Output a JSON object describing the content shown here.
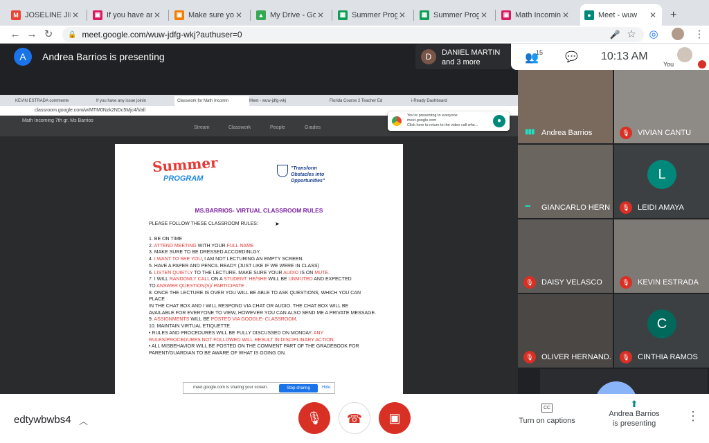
{
  "browser": {
    "tabs": [
      {
        "title": "JOSELINE JIME",
        "favicon": "gmail-icon",
        "color": "#ea4335",
        "glyph": "M"
      },
      {
        "title": "If you have any",
        "favicon": "classroom-icon",
        "color": "#d81b60",
        "glyph": "▣"
      },
      {
        "title": "Make sure you",
        "favicon": "classroom-icon",
        "color": "#f57c00",
        "glyph": "▣"
      },
      {
        "title": "My Drive - Goo",
        "favicon": "drive-icon",
        "color": "#34a853",
        "glyph": "▲"
      },
      {
        "title": "Summer Progr",
        "favicon": "sheets-icon",
        "color": "#0f9d58",
        "glyph": "▦"
      },
      {
        "title": "Summer Progr",
        "favicon": "sheets-icon",
        "color": "#0f9d58",
        "glyph": "▦"
      },
      {
        "title": "Math Incoming",
        "favicon": "classroom-icon",
        "color": "#d81b60",
        "glyph": "▣"
      },
      {
        "title": "Meet - wuw",
        "favicon": "meet-icon",
        "color": "#00897b",
        "glyph": "●"
      }
    ],
    "new_tab": "+",
    "url": "meet.google.com/wuw-jdfg-wkj?authuser=0"
  },
  "meet": {
    "presenter_initial": "A",
    "presenting_text": "Andrea Barrios is presenting",
    "other_initial": "D",
    "other_name": "DANIEL MARTIN",
    "other_more": "and 3 more",
    "participant_count": "15",
    "time": "10:13 AM",
    "self_label": "You",
    "meeting_code": "edtywbwbs4",
    "captions_label": "Turn on captions",
    "presenting_line1": "Andrea Barrios",
    "presenting_line2": "is presenting"
  },
  "shared_screen": {
    "inner_tabs": [
      "KEVIN ESTRADA commente",
      "If you have any issue joinin",
      "Classwork for Math Incomin",
      "Meet - wuw-jdfg-wkj",
      "Florida Course 2 Teacher Ed",
      "i-Ready Dashboard"
    ],
    "inner_url": "classroom.google.com/w/MTM0Nzk2NDc5Mjc4/t/all",
    "class_name": "Math Incoming 7th gr. Ms Barrios",
    "class_tabs": [
      "Stream",
      "Classwork",
      "People",
      "Grades"
    ],
    "notice_line1": "You're presenting to everyone",
    "notice_line2": "meet.google.com",
    "notice_line3": "Click here to return to the video call whe...",
    "share_text": "meet.google.com is sharing your screen.",
    "stop_sharing": "Stop sharing",
    "hide": "Hide"
  },
  "document": {
    "logo_top": "Summer",
    "logo_bottom": "PROGRAM",
    "tagline": "\"Transform Obstacles into Opportunities\"",
    "title": "MS.BARRIOS- VIRTUAL CLASSROOM RULES",
    "intro": "PLEASE FOLLOW THESE CLASSROOM RULES:",
    "rules": [
      [
        {
          "t": "1. BE ON TIME"
        }
      ],
      [
        {
          "t": "2. "
        },
        {
          "t": "ATTEND MEETING",
          "r": 1
        },
        {
          "t": " WITH YOUR "
        },
        {
          "t": "FULL NAME",
          "r": 1
        }
      ],
      [
        {
          "t": "3. MAKE SURE TO BE DRESSED ACCORDINLGY."
        }
      ],
      [
        {
          "t": "4. "
        },
        {
          "t": "I WANT TO SEE YOU",
          "r": 1
        },
        {
          "t": ", I AM NOT LECTURING AN EMPTY SCREEN."
        }
      ],
      [
        {
          "t": "5. HAVE A PAPER AND PENCIL READY (JUST LIKE IF WE WERE IN CLASS)"
        }
      ],
      [
        {
          "t": "6. "
        },
        {
          "t": "LISTEN QUIETLY",
          "r": 1
        },
        {
          "t": " TO THE LECTURE. MAKE SURE YOUR "
        },
        {
          "t": "AUDIO",
          "r": 1
        },
        {
          "t": " IS ON "
        },
        {
          "t": "MUTE",
          "r": 1
        },
        {
          "t": "."
        }
      ],
      [
        {
          "t": "7. I WILL "
        },
        {
          "t": "RANDOMLY CALL",
          "r": 1
        },
        {
          "t": " ON A "
        },
        {
          "t": "STUDENT",
          "r": 1
        },
        {
          "t": ". "
        },
        {
          "t": "HE/SHE",
          "r": 1
        },
        {
          "t": " WILL BE "
        },
        {
          "t": "UNMUTED",
          "r": 1
        },
        {
          "t": " AND EXPECTED"
        }
      ],
      [
        {
          "t": "TO "
        },
        {
          "t": "ANSWER QUESTION(S)/ PARTICIPATE",
          "r": 1
        },
        {
          "t": " ."
        }
      ],
      [
        {
          "t": "8. ONCE THE LECTURE IS OVER YOU WILL BE ABLE TO ASK QUESTIONS, WHICH YOU CAN PLACE"
        }
      ],
      [
        {
          "t": "IN THE CHAT BOX AND I WILL RESPOND VIA CHAT OR AUDIO. THE CHAT BOX WILL BE"
        }
      ],
      [
        {
          "t": "AVAILABLE FOR EVERYONE TO VIEW, HOWEVER YOU CAN ALSO SEND ME A PRIVATE MESSAGE."
        }
      ],
      [
        {
          "t": "9. "
        },
        {
          "t": "ASSIGNMENTS",
          "r": 1
        },
        {
          "t": " WILL BE "
        },
        {
          "t": "POSTED VIA GOOGLE- CLASSROOM",
          "r": 1
        },
        {
          "t": "."
        }
      ],
      [
        {
          "t": "10. MAINTAIN VIRTUAL ETIQUETTE."
        }
      ],
      [
        {
          "t": "      •     RULES AND PROCEDURES WILL BE FULLY DISCUSSED ON MONDAY. "
        },
        {
          "t": "ANY",
          "r": 1
        }
      ],
      [
        {
          "t": "RULES/PROCEDURES NOT FOLLOWED WILL RESULT IN DISCIPLINARY ACTION.",
          "r": 1
        }
      ],
      [
        {
          "t": "      •     ALL MISBEHAVIOR WILL BE POSTED ON THE COMMENT PART OF THE GRADEBOOK FOR"
        }
      ],
      [
        {
          "t": "PARENT/GUARDIAN TO BE AWARE OF WHAT IS GOING ON."
        }
      ]
    ]
  },
  "participants": [
    {
      "name": "Andrea Barrios",
      "status": "speaking",
      "bg": "#7a6a5e"
    },
    {
      "name": "VIVIAN CANTU",
      "status": "muted",
      "bg": "#8e8a86"
    },
    {
      "name": "GIANCARLO HERN...",
      "status": "active",
      "bg": "#6b6560"
    },
    {
      "name": "LEIDI AMAYA",
      "status": "muted",
      "bg": "#3c4043",
      "initial": "L",
      "avatar_color": "#00897b"
    },
    {
      "name": "DAISY VELASCO",
      "status": "muted",
      "bg": "#5d5a58"
    },
    {
      "name": "KEVIN ESTRADA",
      "status": "muted",
      "bg": "#7d7a76"
    },
    {
      "name": "OLIVER HERNAND...",
      "status": "muted",
      "bg": "#4a4745"
    },
    {
      "name": "CINTHIA RAMOS",
      "status": "muted",
      "bg": "#3c4043",
      "initial": "C",
      "avatar_color": "#00695c"
    }
  ]
}
